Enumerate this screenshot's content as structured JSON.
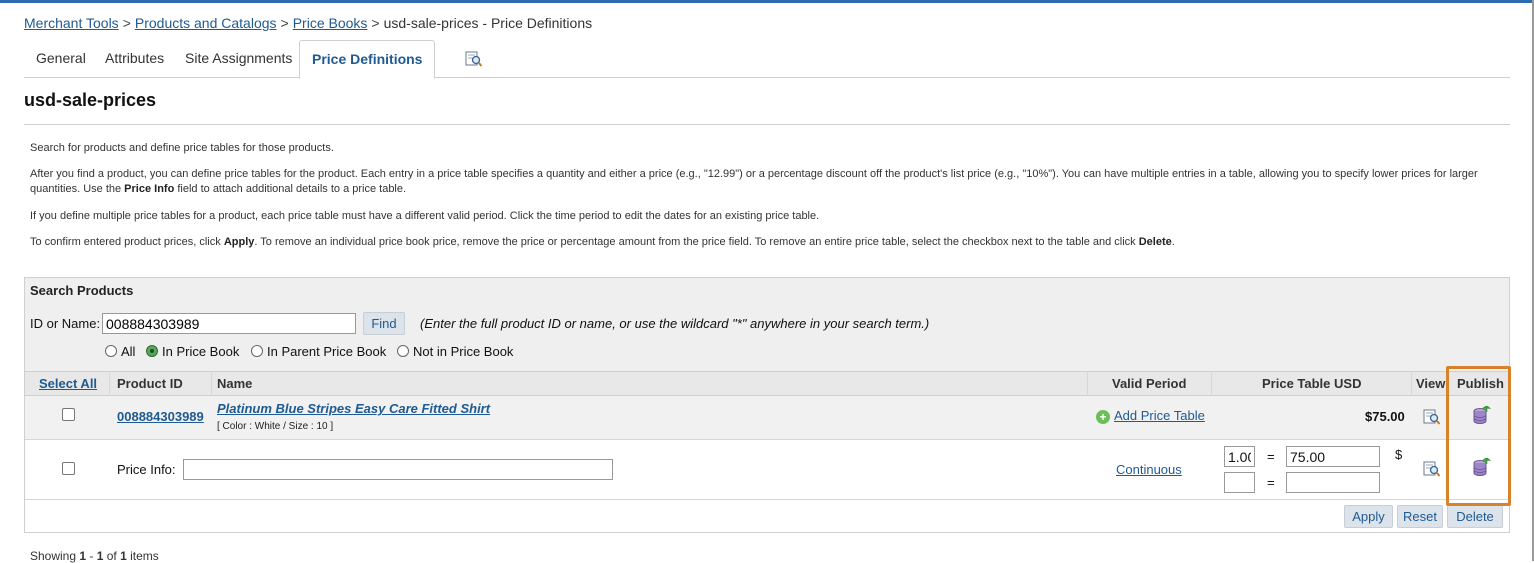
{
  "breadcrumb": {
    "items": [
      "Merchant Tools",
      "Products and Catalogs",
      "Price Books"
    ],
    "separator": ">",
    "current": "usd-sale-prices - Price Definitions"
  },
  "tabs": [
    {
      "label": "General"
    },
    {
      "label": "Attributes"
    },
    {
      "label": "Site Assignments"
    },
    {
      "label": "Price Definitions",
      "active": true
    }
  ],
  "tab_icon": "preview-magnifier-icon",
  "page_title": "usd-sale-prices",
  "help": {
    "p1": "Search for products and define price tables for those products.",
    "p2a": "After you find a product, you can define price tables for the product. Each entry in a price table specifies a quantity and either a price (e.g., \"12.99\") or a percentage discount off the product's list price (e.g., \"10%\"). You can have multiple entries in a table, allowing you to specify lower prices for larger",
    "p2b_pre": "quantities. Use the ",
    "p2b_bold": "Price Info",
    "p2b_post": " field to attach additional details to a price table.",
    "p3": "If you define multiple price tables for a product, each price table must have a different valid period. Click the time period to edit the dates for an existing price table.",
    "p4_pre": "To confirm entered product prices, click ",
    "p4_b1": "Apply",
    "p4_mid": ". To remove an individual price book price, remove the price or percentage amount from the price field. To remove an entire price table, select the checkbox next to the table and click ",
    "p4_b2": "Delete",
    "p4_post": "."
  },
  "search": {
    "title": "Search Products",
    "id_label": "ID or Name:",
    "id_value": "008884303989",
    "find_label": "Find",
    "hint": "(Enter the full product ID or name, or use the wildcard \"*\" anywhere in your search term.)",
    "radios": [
      {
        "label": "All",
        "selected": false
      },
      {
        "label": "In Price Book",
        "selected": true
      },
      {
        "label": "In Parent Price Book",
        "selected": false
      },
      {
        "label": "Not in Price Book",
        "selected": false
      }
    ]
  },
  "grid": {
    "headers": {
      "select_all": "Select All",
      "product_id": "Product ID",
      "name": "Name",
      "valid_period": "Valid Period",
      "price_table": "Price Table USD",
      "view": "View",
      "publish": "Publish"
    },
    "product": {
      "id": "008884303989",
      "name": "Platinum Blue Stripes Easy Care Fitted Shirt",
      "attributes": "[ Color :  White / Size :  10 ]",
      "add_price_table": "Add Price Table",
      "price": "$75.00"
    },
    "price_table_row": {
      "price_info_label": "Price Info:",
      "price_info_value": "",
      "valid_period": "Continuous",
      "entries": [
        {
          "quantity": "1.00",
          "equals": "=",
          "price": "75.00",
          "currency": "$"
        },
        {
          "quantity": "",
          "equals": "=",
          "price": ""
        }
      ]
    }
  },
  "actions": {
    "apply": "Apply",
    "reset": "Reset",
    "delete": "Delete"
  },
  "footer": {
    "pre": "Showing ",
    "from": "1",
    "sep1": " - ",
    "to": "1",
    "sep2": " of ",
    "total": "1",
    "post": " items"
  },
  "colors": {
    "link": "#1f5a92",
    "highlight": "#d8832b",
    "header_bg": "#e8e8e8",
    "search_bg": "#efefef"
  },
  "icons": {
    "view": "magnifier-icon",
    "publish": "publish-database-icon",
    "add": "plus-circle-icon"
  }
}
